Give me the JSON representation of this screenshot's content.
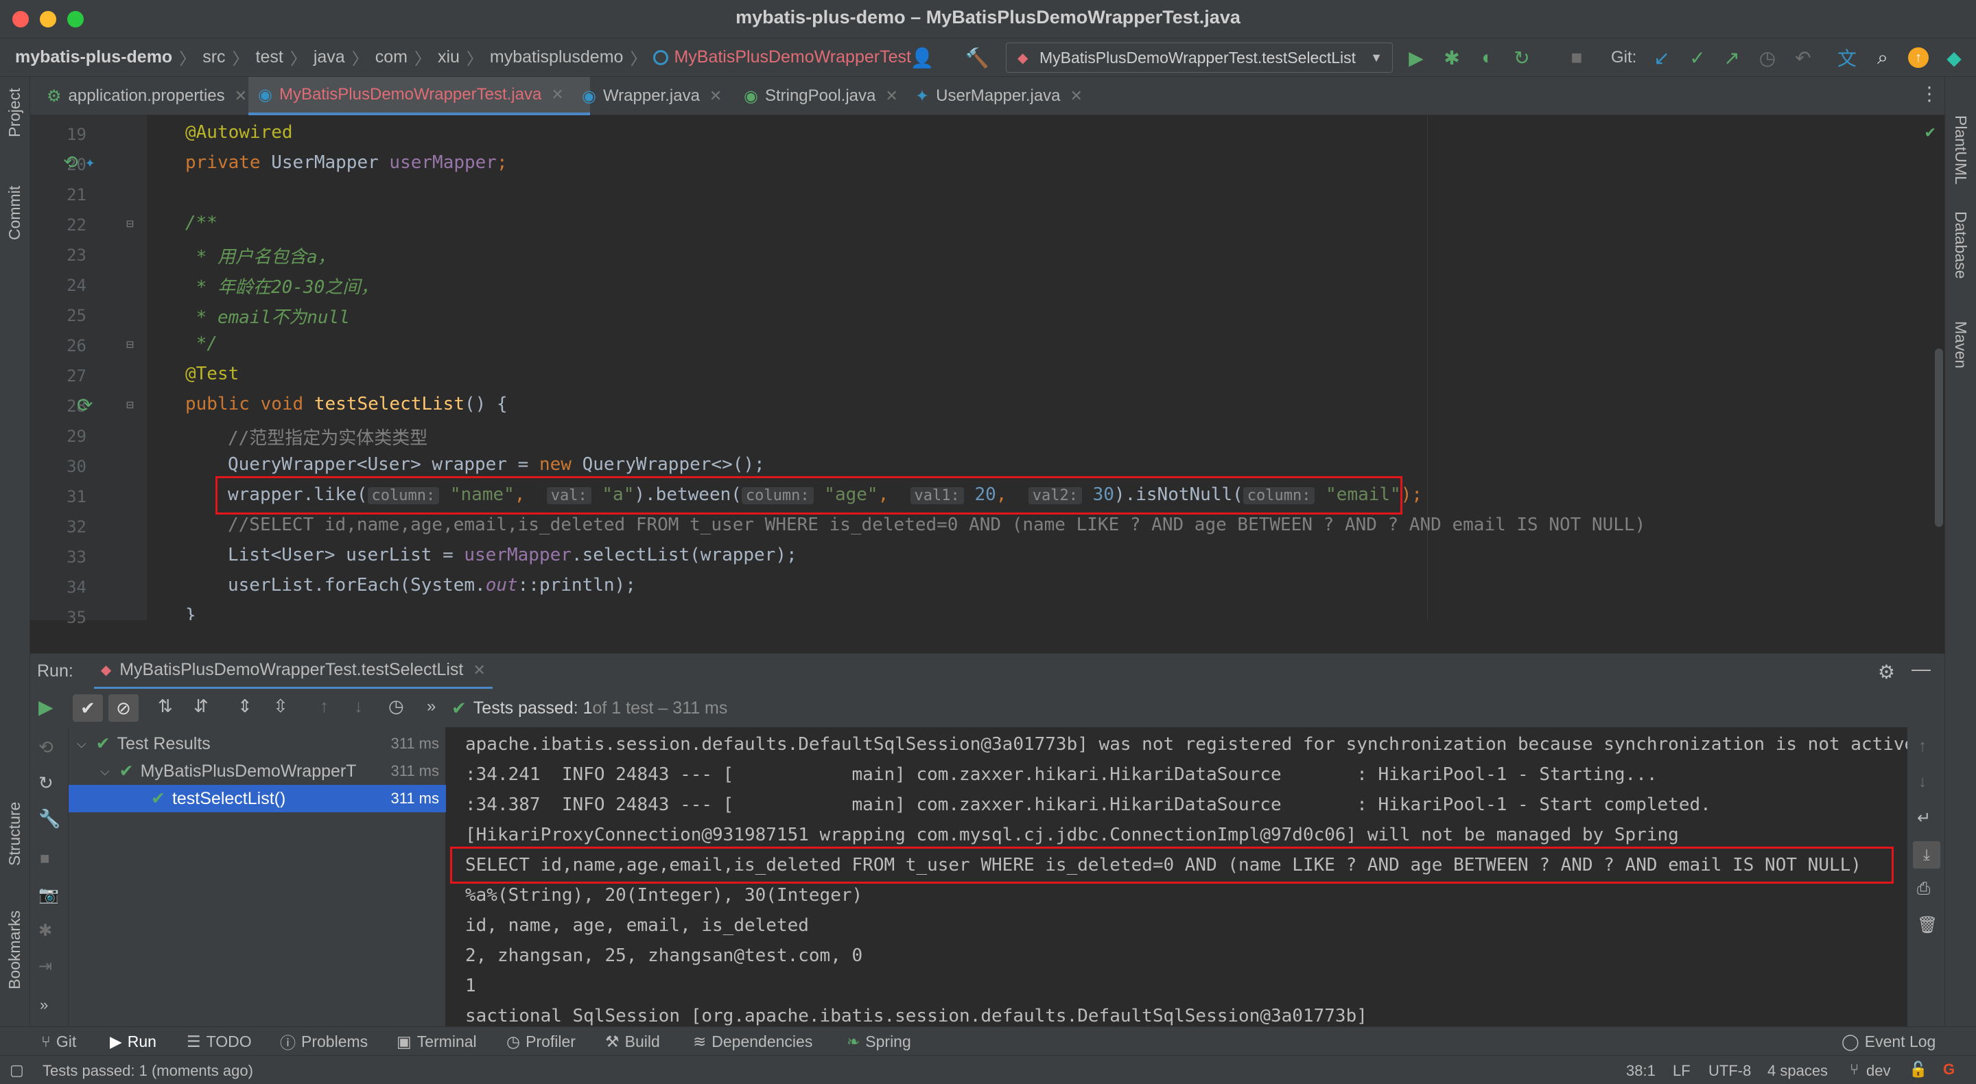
{
  "window": {
    "title": "mybatis-plus-demo – MyBatisPlusDemoWrapperTest.java"
  },
  "breadcrumbs": [
    "mybatis-plus-demo",
    "src",
    "test",
    "java",
    "com",
    "xiu",
    "mybatisplusdemo",
    "MyBatisPlusDemoWrapperTest"
  ],
  "toolbar": {
    "run_config": "MyBatisPlusDemoWrapperTest.testSelectList",
    "git_label": "Git:"
  },
  "tabs": [
    {
      "label": "application.properties"
    },
    {
      "label": "MyBatisPlusDemoWrapperTest.java"
    },
    {
      "label": "Wrapper.java"
    },
    {
      "label": "StringPool.java"
    },
    {
      "label": "UserMapper.java"
    }
  ],
  "side_left": {
    "project": "Project",
    "commit": "Commit",
    "structure": "Structure",
    "bookmarks": "Bookmarks"
  },
  "side_right": {
    "plantuml": "PlantUML",
    "database": "Database",
    "maven": "Maven"
  },
  "editor": {
    "line_numbers": [
      "19",
      "20",
      "21",
      "22",
      "23",
      "24",
      "25",
      "26",
      "27",
      "28",
      "29",
      "30",
      "31",
      "32",
      "33",
      "34",
      "35"
    ],
    "l19": "@Autowired",
    "l20_kw": "private ",
    "l20_type": "UserMapper ",
    "l20_field": "userMapper",
    "l20_end": ";",
    "l22": "/**",
    "l23": " * 用户名包含a，",
    "l24": " * 年龄在20-30之间，",
    "l25": " * email不为null",
    "l26": " */",
    "l27": "@Test",
    "l28_kw": "public void ",
    "l28_name": "testSelectList",
    "l28_end": "() {",
    "l29": "//范型指定为实体类类型",
    "l30_a": "QueryWrapper<User> wrapper = ",
    "l30_new": "new ",
    "l30_b": "QueryWrapper<>();",
    "l31_a": "wrapper.like(",
    "l31_h1": "column:",
    "l31_s1": "\"name\"",
    "l31_c1": ", ",
    "l31_h2": "val:",
    "l31_s2": "\"a\"",
    "l31_b": ").between(",
    "l31_h3": "column:",
    "l31_s3": "\"age\"",
    "l31_c3": ", ",
    "l31_h4": "val1:",
    "l31_n1": "20",
    "l31_c4": ", ",
    "l31_h5": "val2:",
    "l31_n2": "30",
    "l31_c": ").isNotNull(",
    "l31_h6": "column:",
    "l31_s6": "\"email\"",
    "l31_end": ");",
    "l32": "//SELECT id,name,age,email,is_deleted FROM t_user WHERE is_deleted=0 AND (name LIKE ? AND age BETWEEN ? AND ? AND email IS NOT NULL)",
    "l33_a": "List<User> userList = ",
    "l33_field": "userMapper",
    "l33_b": ".selectList(wrapper);",
    "l34_a": "userList.forEach(System.",
    "l34_out": "out",
    "l34_b": "::println);",
    "l35": "}"
  },
  "run": {
    "label": "Run:",
    "tab": "MyBatisPlusDemoWrapperTest.testSelectList",
    "status_bold": "Tests passed: 1",
    "status_rest": " of 1 test – 311 ms",
    "tree": [
      {
        "label": "Test Results",
        "duration": "311 ms"
      },
      {
        "label": "MyBatisPlusDemoWrapperT",
        "duration": "311 ms"
      },
      {
        "label": "testSelectList()",
        "duration": "311 ms"
      }
    ],
    "console": [
      "apache.ibatis.session.defaults.DefaultSqlSession@3a01773b] was not registered for synchronization because synchronization is not active",
      ":34.241  INFO 24843 --- [           main] com.zaxxer.hikari.HikariDataSource       : HikariPool-1 - Starting...",
      ":34.387  INFO 24843 --- [           main] com.zaxxer.hikari.HikariDataSource       : HikariPool-1 - Start completed.",
      "[HikariProxyConnection@931987151 wrapping com.mysql.cj.jdbc.ConnectionImpl@97d0c06] will not be managed by Spring",
      "SELECT id,name,age,email,is_deleted FROM t_user WHERE is_deleted=0 AND (name LIKE ? AND age BETWEEN ? AND ? AND email IS NOT NULL)",
      "%a%(String), 20(Integer), 30(Integer)",
      "id, name, age, email, is_deleted",
      "2, zhangsan, 25, zhangsan@test.com, 0",
      "1",
      "sactional SqlSession [org.apache.ibatis.session.defaults.DefaultSqlSession@3a01773b]"
    ]
  },
  "tool_tabs": {
    "git": "Git",
    "run": "Run",
    "todo": "TODO",
    "problems": "Problems",
    "terminal": "Terminal",
    "profiler": "Profiler",
    "build": "Build",
    "dependencies": "Dependencies",
    "spring": "Spring",
    "event_log": "Event Log"
  },
  "status": {
    "message": "Tests passed: 1 (moments ago)",
    "position": "38:1",
    "line_sep": "LF",
    "encoding": "UTF-8",
    "indent": "4 spaces",
    "branch": "dev"
  }
}
